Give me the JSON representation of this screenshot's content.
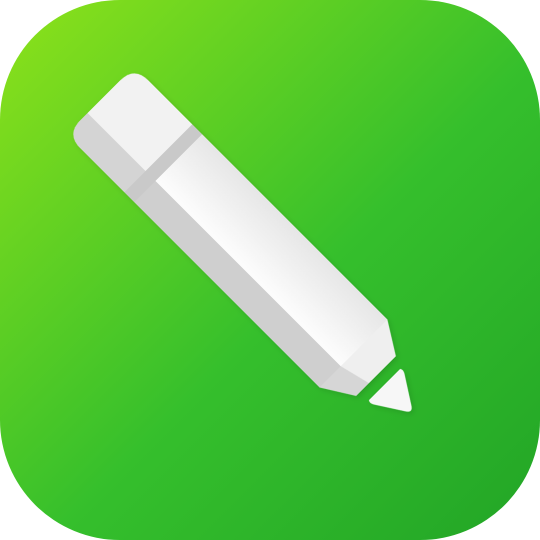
{
  "icon": {
    "name": "pencil-app-icon",
    "glyph": "pencil-icon",
    "colors": {
      "gradient_start": "#8ee21a",
      "gradient_end": "#22a526",
      "pencil_body": "#f4f4f4",
      "pencil_shade": "#c9c9c9",
      "pencil_tip": "#f7f7f7"
    }
  }
}
